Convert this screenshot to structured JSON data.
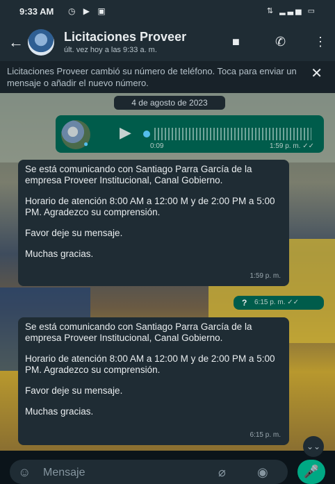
{
  "status": {
    "time": "9:33 AM",
    "left_icons": "◷ ▶ ▣",
    "right_icons": "⇅ ▂▃▅ ▭"
  },
  "header": {
    "title": "Licitaciones Proveer",
    "subtitle": "últ. vez hoy a las 9:33 a. m.",
    "back_icon": "←",
    "video_icon": "■",
    "call_icon": "✆",
    "menu_icon": "⋮"
  },
  "banner": {
    "text": "Licitaciones Proveer cambió su número de teléfono. Toca para enviar un mensaje o añadir el nuevo número.",
    "close_icon": "✕"
  },
  "chat": {
    "date_label": "4 de agosto de 2023",
    "voice_message": {
      "duration": "0:09",
      "time": "1:59 p. m. ✓✓",
      "play_icon": "▶",
      "mic_icon": "●"
    },
    "auto_reply_1": {
      "p1": "Se está comunicando con Santiago Parra García de la empresa Proveer Institucional, Canal Gobierno.",
      "p2": "Horario de atención 8:00 AM a 12:00 M y de 2:00 PM a 5:00 PM. Agradezco su comprensión.",
      "p3": "Favor deje su mensaje.",
      "p4": "Muchas gracias.",
      "time": "1:59 p. m."
    },
    "sent_message": {
      "text": "?",
      "time": "6:15 p. m. ✓✓"
    },
    "auto_reply_2": {
      "p1": "Se está comunicando con Santiago Parra García de la empresa Proveer Institucional, Canal Gobierno.",
      "p2": "Horario de atención 8:00 AM a 12:00 M y de 2:00 PM a 5:00 PM. Agradezco su comprensión.",
      "p3": "Favor deje su mensaje.",
      "p4": "Muchas gracias.",
      "time": "6:15 p. m."
    },
    "scroll_down_icon": "⌄⌄"
  },
  "composer": {
    "placeholder": "Mensaje",
    "emoji_icon": "☺",
    "attach_icon": "⌀",
    "camera_icon": "◉",
    "mic_icon": "🎤"
  }
}
